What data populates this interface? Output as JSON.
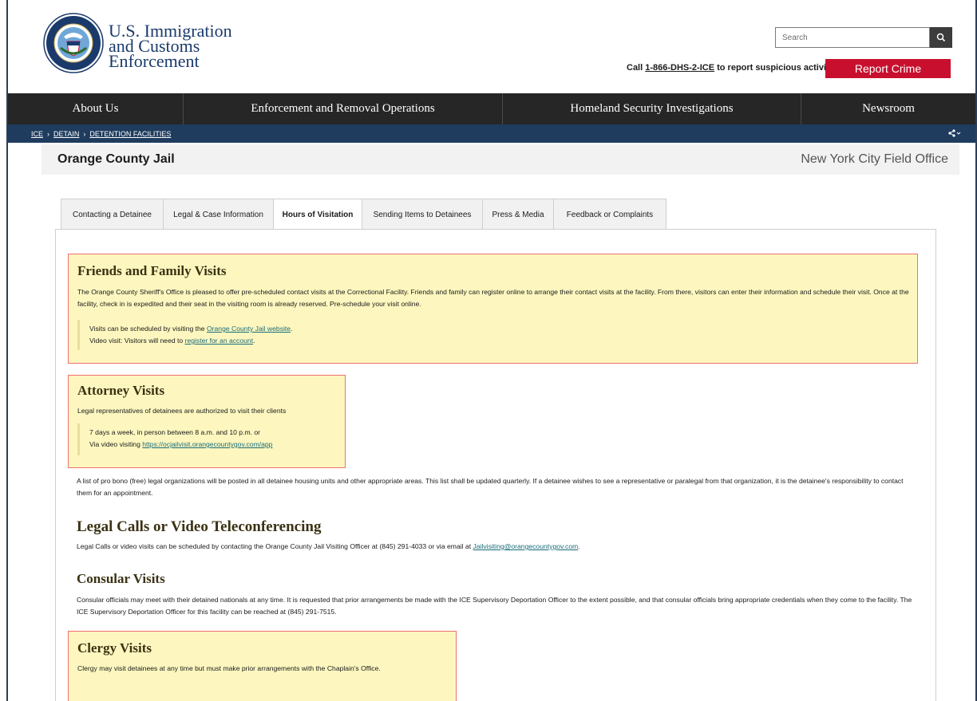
{
  "header": {
    "agency_line1": "U.S. Immigration",
    "agency_line2": "and Customs",
    "agency_line3": "Enforcement",
    "seal_icon": "dhs-seal-icon",
    "search_placeholder": "Search",
    "report_prefix": "Call ",
    "report_phone": "1-866-DHS-2-ICE",
    "report_suffix": " to report suspicious activity",
    "report_button": "Report Crime",
    "report_button_color": "#c8102e"
  },
  "nav": {
    "items": [
      {
        "label": "About Us"
      },
      {
        "label": "Enforcement and Removal Operations"
      },
      {
        "label": "Homeland Security Investigations"
      },
      {
        "label": "Newsroom"
      }
    ]
  },
  "breadcrumb": {
    "items": [
      "ICE",
      "DETAIN",
      "DETENTION FACILITIES"
    ],
    "separator": "›",
    "share_icon": "share-icon"
  },
  "page": {
    "title": "Orange County Jail",
    "field_office": "New York City Field Office"
  },
  "tabs": [
    {
      "label": "Contacting a Detainee",
      "active": false
    },
    {
      "label": "Legal & Case Information",
      "active": false
    },
    {
      "label": "Hours of Visitation",
      "active": true
    },
    {
      "label": "Sending Items to Detainees",
      "active": false
    },
    {
      "label": "Press & Media",
      "active": false
    },
    {
      "label": "Feedback or Complaints",
      "active": false
    }
  ],
  "sections": {
    "friends": {
      "heading": "Friends and Family Visits",
      "body": "The Orange County Sheriff's Office is pleased to offer pre-scheduled contact visits at the Correctional Facility. Friends and family can register online to arrange their contact visits at the facility. From there, visitors can enter their information and schedule their visit. Once at the facility, check in is expedited and their seat in the visiting room is already reserved. Pre-schedule your visit online.",
      "line1_prefix": "Visits can be scheduled by visiting the ",
      "line1_link": "Orange County Jail website",
      "line1_suffix": ".",
      "line2_prefix": "Video visit: Visitors will need to ",
      "line2_link": "register for an account",
      "line2_suffix": "."
    },
    "attorney": {
      "heading": "Attorney Visits",
      "body": "Legal representatives of detainees are authorized to visit their clients",
      "line1": "7 days a week, in person between 8 a.m. and 10 p.m. or",
      "line2_prefix": "Via video visiting ",
      "line2_link": "https://ocjailvisit.orangecountygov.com/app",
      "after": "A list of pro bono (free) legal organizations will be posted in all detainee housing units and other appropriate areas. This list shall be updated quarterly. If a detainee wishes to see a representative or paralegal from that organization, it is the detainee's responsibility to contact them for an appointment."
    },
    "legal_calls": {
      "heading": "Legal Calls or Video Teleconferencing",
      "body_prefix": "Legal Calls or video visits can be scheduled by contacting the Orange County Jail Visiting Officer at (845) 291-4033 or via email at ",
      "email": "Jailvisiting@orangecountygov.com",
      "body_suffix": "."
    },
    "consular": {
      "heading": "Consular Visits",
      "body": "Consular officials may meet with their detained nationals at any time. It is requested that prior arrangements be made with the ICE Supervisory Deportation Officer to the extent possible, and that consular officials bring appropriate credentials when they come to the facility. The ICE Supervisory Deportation Officer for this facility can be reached at (845) 291-7515."
    },
    "clergy": {
      "heading": "Clergy Visits",
      "body": "Clergy may visit detainees at any time but must make prior arrangements with the Chaplain's Office."
    }
  }
}
